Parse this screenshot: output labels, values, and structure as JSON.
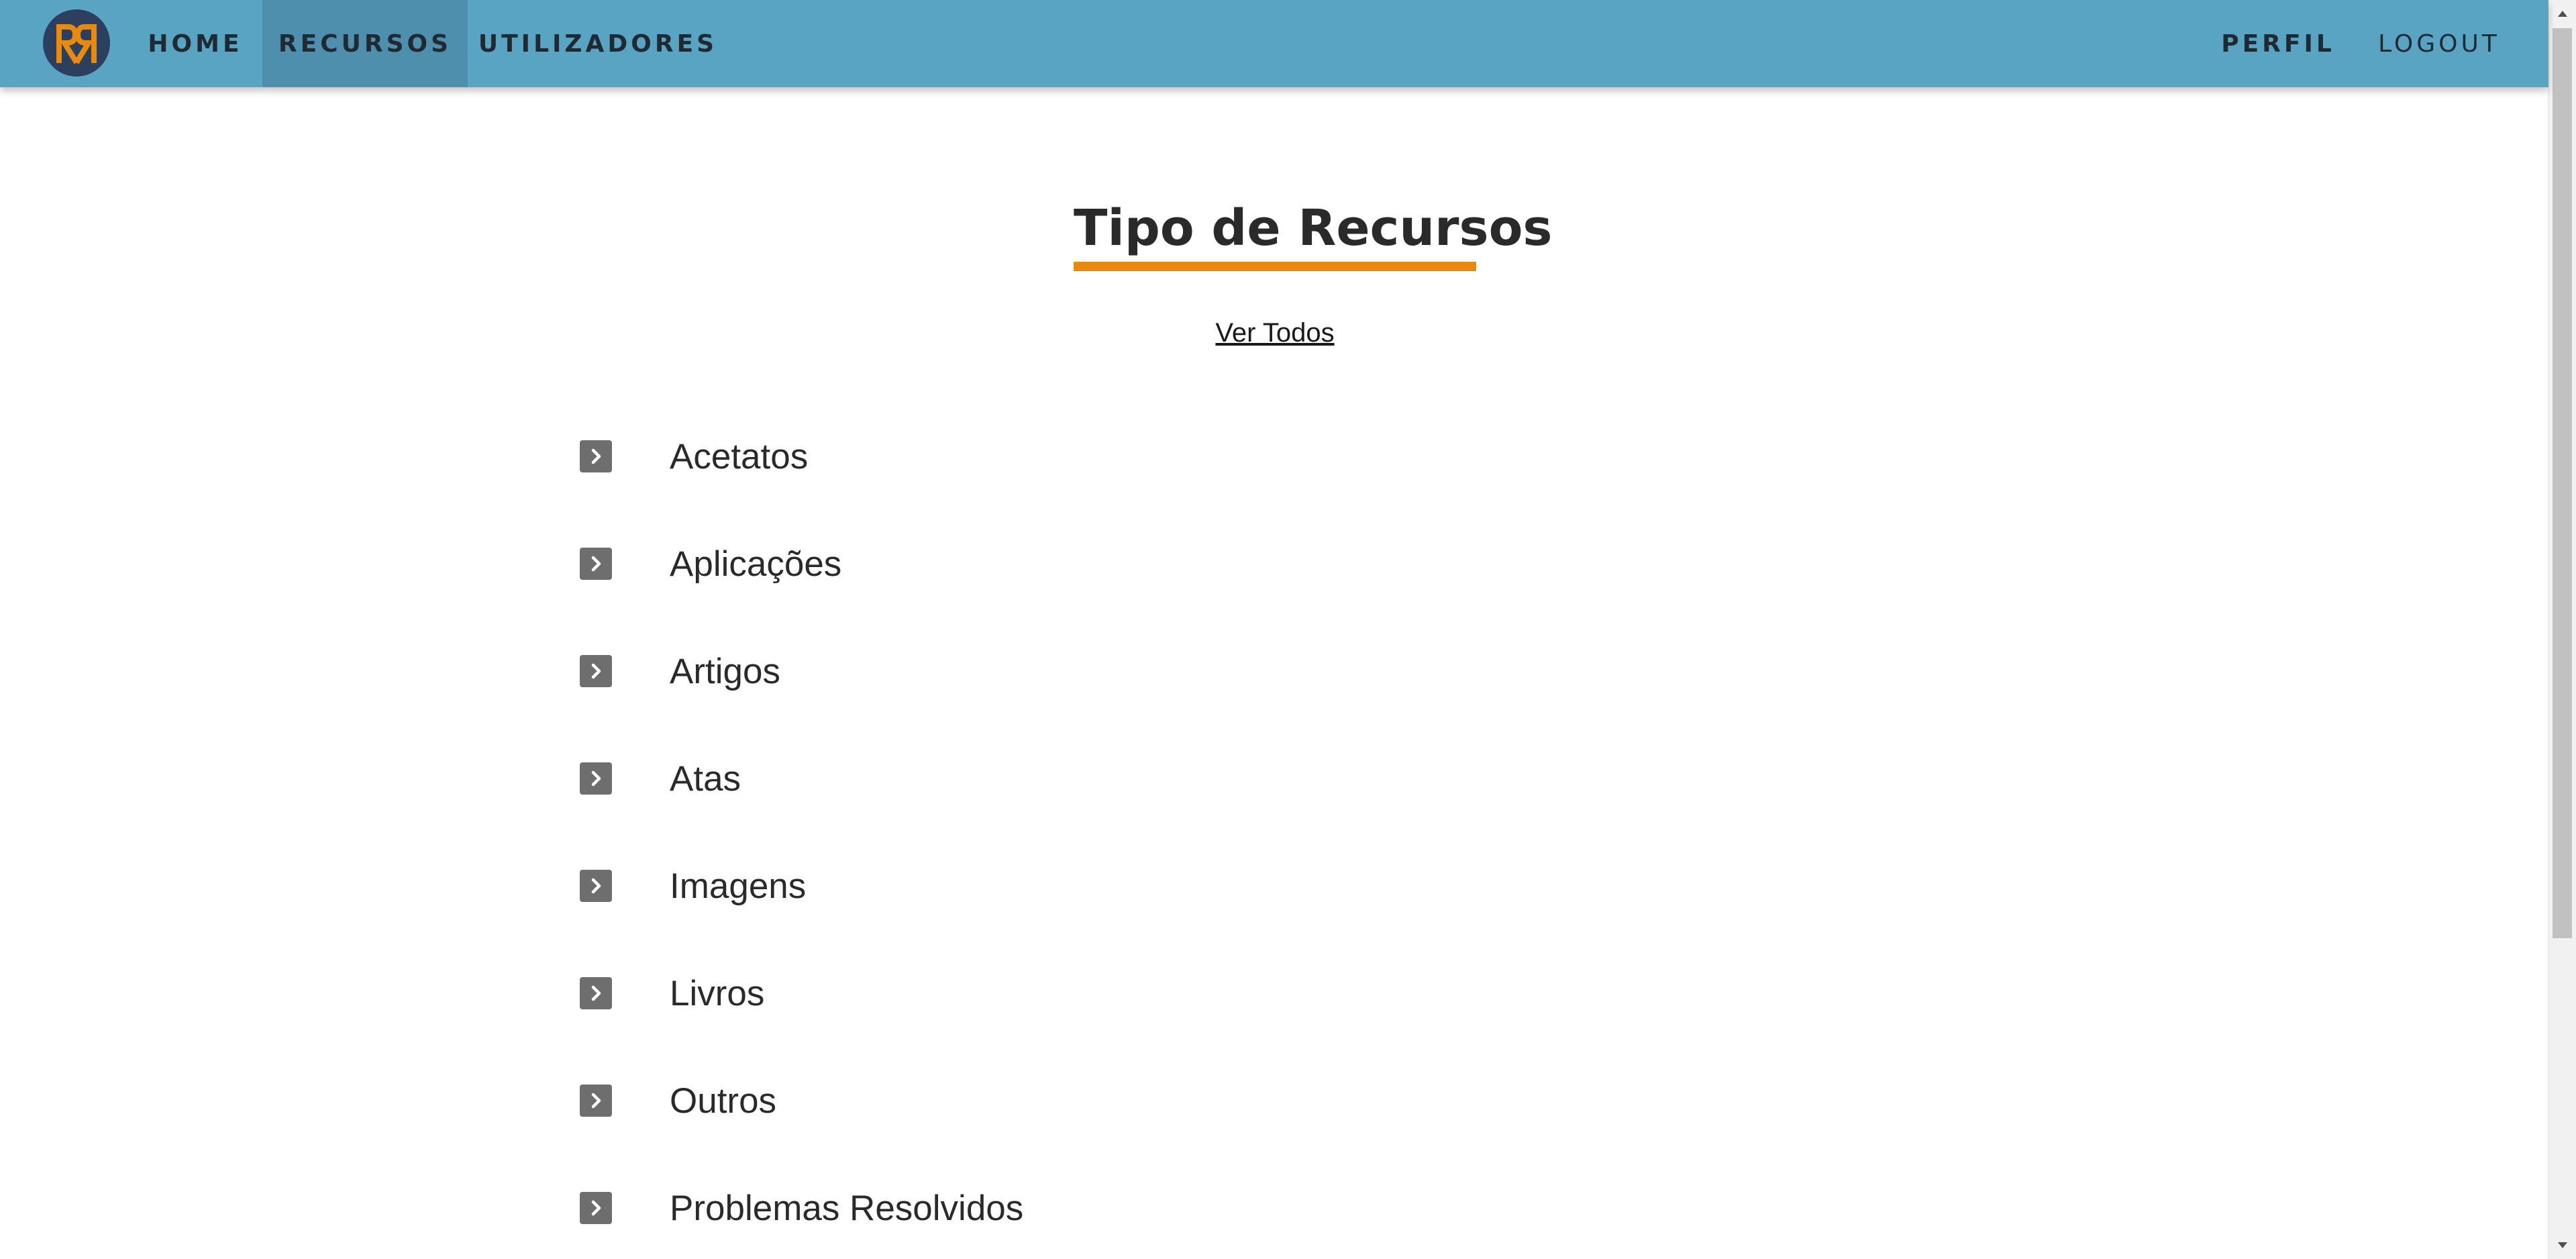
{
  "app": {
    "logo_text": "RR",
    "accent_color": "#e88a0e",
    "navbar_color": "#59a3c3",
    "active_nav_color": "#4e8fad"
  },
  "nav": {
    "home": "HOME",
    "recursos": "RECURSOS",
    "utilizadores": "UTILIZADORES",
    "perfil": "PERFIL",
    "logout": "LOGOUT",
    "active": "RECURSOS"
  },
  "main": {
    "title": "Tipo de Recursos",
    "ver_todos": "Ver Todos",
    "item_icon": "chevron-right-square-icon",
    "resource_types": [
      "Acetatos",
      "Aplicações",
      "Artigos",
      "Atas",
      "Imagens",
      "Livros",
      "Outros",
      "Problemas Resolvidos"
    ]
  }
}
